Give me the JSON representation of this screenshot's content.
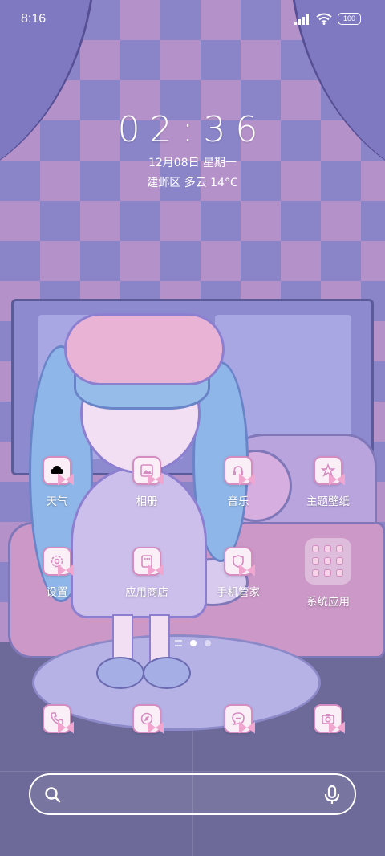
{
  "status_bar": {
    "time": "8:16",
    "battery": "100"
  },
  "clock_widget": {
    "time": "02:36",
    "date": "12月08日 星期一",
    "weather": "建邺区 多云 14°C"
  },
  "apps_row1": [
    {
      "label": "天气",
      "icon": "weather-icon"
    },
    {
      "label": "相册",
      "icon": "gallery-icon"
    },
    {
      "label": "音乐",
      "icon": "music-icon"
    },
    {
      "label": "主题壁纸",
      "icon": "themes-icon"
    }
  ],
  "apps_row2": [
    {
      "label": "设置",
      "icon": "settings-icon"
    },
    {
      "label": "应用商店",
      "icon": "app-store-icon"
    },
    {
      "label": "手机管家",
      "icon": "security-icon"
    },
    {
      "label": "系统应用",
      "icon": "folder-icon"
    }
  ],
  "dock": [
    {
      "icon": "phone-icon"
    },
    {
      "icon": "browser-icon"
    },
    {
      "icon": "messages-icon"
    },
    {
      "icon": "camera-icon"
    }
  ],
  "page_indicator": {
    "pages": 2,
    "active": 1
  },
  "colors": {
    "icon_border": "#d58cc0",
    "icon_bg": "#fbeff7",
    "checker_a": "#8a84c8",
    "checker_b": "#b591c9"
  }
}
